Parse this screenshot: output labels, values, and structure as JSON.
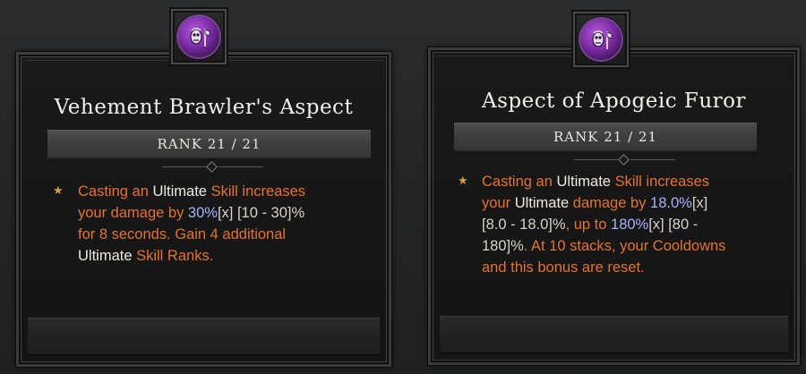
{
  "aspects": [
    {
      "title": "Vehement Brawler's Aspect",
      "rank": "RANK 21 / 21",
      "icon": "purple-skull-axe-icon",
      "desc": {
        "l1a": "Casting an ",
        "l1b": "Ultimate",
        "l1c": " Skill increases",
        "l2a": "your damage by ",
        "l2b": "30%",
        "l2c": "[x] [10 - 30]%",
        "l3": "for 8 seconds. Gain 4 additional",
        "l4a": "Ultimate",
        "l4b": " Skill Ranks."
      }
    },
    {
      "title": "Aspect of Apogeic Furor",
      "rank": "RANK 21 / 21",
      "icon": "purple-skull-axe-icon",
      "desc": {
        "l1a": "Casting an ",
        "l1b": "Ultimate",
        "l1c": " Skill increases",
        "l2a": "your ",
        "l2b": "Ultimate",
        "l2c": " damage by ",
        "l2d": "18.0%",
        "l2e": "[x]",
        "l3a": "[8.0 - 18.0]%",
        "l3b": ", up to ",
        "l3c": "180%",
        "l3d": "[x] [80 -",
        "l4a": "180]%",
        "l4b": ". At 10 stacks, your Cooldowns",
        "l5": "and this bonus are reset."
      }
    }
  ],
  "colors": {
    "affix_orange": "#e5722f",
    "keyword_white": "#eeeae2",
    "value_blue": "#a9b3ff",
    "range_grey": "#d7d3cb",
    "star_gold": "#d4a143",
    "orb_purple": "#7c2da6"
  }
}
